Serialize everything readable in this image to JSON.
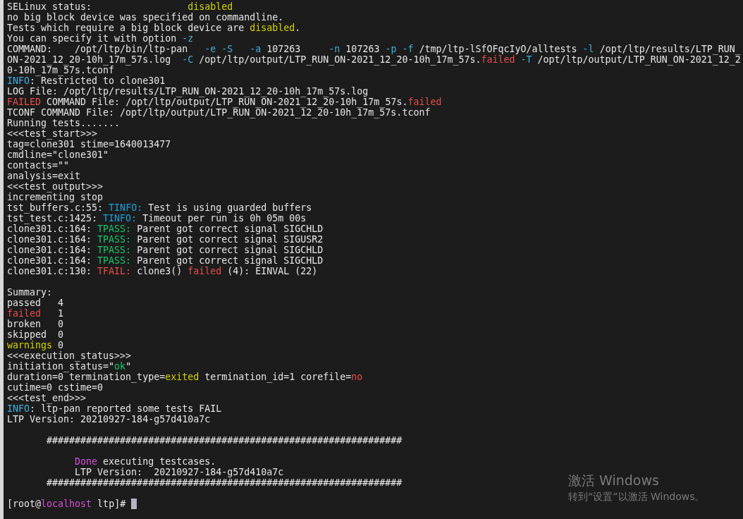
{
  "lines": [
    {
      "kind": "text",
      "segments": [
        {
          "text": "SELinux status:                 "
        },
        {
          "text": "disabled",
          "color": "#d4d400"
        }
      ]
    },
    {
      "kind": "text",
      "segments": [
        {
          "text": "no big block device was specified on commandline."
        }
      ]
    },
    {
      "kind": "text",
      "segments": [
        {
          "text": "Tests which require a big block device are "
        },
        {
          "text": "disabled",
          "color": "#d4d400"
        },
        {
          "text": "."
        }
      ]
    },
    {
      "kind": "text",
      "segments": [
        {
          "text": "You can specify it with option "
        },
        {
          "text": "-z",
          "color": "#3fb0dc"
        }
      ]
    },
    {
      "kind": "text",
      "segments": [
        {
          "text": "COMMAND:    /opt/ltp/bin/ltp-pan   "
        },
        {
          "text": "-e -S   -a",
          "color": "#3fb0dc"
        },
        {
          "text": " 107263     "
        },
        {
          "text": "-n",
          "color": "#3fb0dc"
        },
        {
          "text": " 107263 "
        },
        {
          "text": "-p -f",
          "color": "#3fb0dc"
        },
        {
          "text": " /tmp/ltp-lSfOFqcIyO/alltests "
        },
        {
          "text": "-l",
          "color": "#3fb0dc"
        },
        {
          "text": " /opt/ltp/results/LTP_RUN_"
        }
      ]
    },
    {
      "kind": "text",
      "segments": [
        {
          "text": "ON-2021_12_20-10h_17m_57s.log  "
        },
        {
          "text": "-C",
          "color": "#3fb0dc"
        },
        {
          "text": " /opt/ltp/output/LTP_RUN_ON-2021_12_20-10h_17m_57s."
        },
        {
          "text": "failed",
          "color": "#e84c4c"
        },
        {
          "text": " -T",
          "color": "#3fb0dc"
        },
        {
          "text": " /opt/ltp/output/LTP_RUN_ON-2021_12_2"
        }
      ]
    },
    {
      "kind": "text",
      "segments": [
        {
          "text": "0-10h_17m_57s.tconf"
        }
      ]
    },
    {
      "kind": "text",
      "segments": [
        {
          "text": "INFO",
          "color": "#3fb0dc"
        },
        {
          "text": ": Restricted to clone301"
        }
      ]
    },
    {
      "kind": "text",
      "segments": [
        {
          "text": "LOG File: /opt/ltp/results/LTP_RUN_ON-2021_12_20-10h_17m_57s.log"
        }
      ]
    },
    {
      "kind": "text",
      "segments": [
        {
          "text": "FAILED",
          "color": "#e84c4c"
        },
        {
          "text": " COMMAND File: /opt/ltp/output/LTP_RUN_ON-2021_12_20-10h_17m_57s."
        },
        {
          "text": "failed",
          "color": "#e84c4c"
        }
      ]
    },
    {
      "kind": "text",
      "segments": [
        {
          "text": "TCONF COMMAND File: /opt/ltp/output/LTP_RUN_ON-2021_12_20-10h_17m_57s.tconf"
        }
      ]
    },
    {
      "kind": "text",
      "segments": [
        {
          "text": "Running tests......."
        }
      ]
    },
    {
      "kind": "text",
      "segments": [
        {
          "text": "<<<test_start>>>"
        }
      ]
    },
    {
      "kind": "text",
      "segments": [
        {
          "text": "tag=clone301 stime=1640013477"
        }
      ]
    },
    {
      "kind": "text",
      "segments": [
        {
          "text": "cmdline=\"clone301\""
        }
      ]
    },
    {
      "kind": "text",
      "segments": [
        {
          "text": "contacts=\"\""
        }
      ]
    },
    {
      "kind": "text",
      "segments": [
        {
          "text": "analysis=exit"
        }
      ]
    },
    {
      "kind": "text",
      "segments": [
        {
          "text": "<<<test_output>>>"
        }
      ]
    },
    {
      "kind": "text",
      "segments": [
        {
          "text": "incrementing stop"
        }
      ]
    },
    {
      "kind": "text",
      "segments": [
        {
          "text": "tst_buffers.c:55: "
        },
        {
          "text": "TINFO:",
          "color": "#1e9fd6"
        },
        {
          "text": " Test is using guarded buffers"
        }
      ]
    },
    {
      "kind": "text",
      "segments": [
        {
          "text": "tst_test.c:1425: "
        },
        {
          "text": "TINFO:",
          "color": "#1e9fd6"
        },
        {
          "text": " Timeout per run is 0h 05m 00s"
        }
      ]
    },
    {
      "kind": "text",
      "segments": [
        {
          "text": "clone301.c:164: "
        },
        {
          "text": "TPASS:",
          "color": "#17c56a"
        },
        {
          "text": " Parent got correct signal SIGCHLD"
        }
      ]
    },
    {
      "kind": "text",
      "segments": [
        {
          "text": "clone301.c:164: "
        },
        {
          "text": "TPASS:",
          "color": "#17c56a"
        },
        {
          "text": " Parent got correct signal SIGUSR2"
        }
      ]
    },
    {
      "kind": "text",
      "segments": [
        {
          "text": "clone301.c:164: "
        },
        {
          "text": "TPASS:",
          "color": "#17c56a"
        },
        {
          "text": " Parent got correct signal SIGCHLD"
        }
      ]
    },
    {
      "kind": "text",
      "segments": [
        {
          "text": "clone301.c:164: "
        },
        {
          "text": "TPASS:",
          "color": "#17c56a"
        },
        {
          "text": " Parent got correct signal SIGCHLD"
        }
      ]
    },
    {
      "kind": "text",
      "segments": [
        {
          "text": "clone301.c:130: "
        },
        {
          "text": "TFAIL:",
          "color": "#e84c4c"
        },
        {
          "text": " clone3() "
        },
        {
          "text": "failed",
          "color": "#e84c4c"
        },
        {
          "text": " (4): EINVAL (22)"
        }
      ]
    },
    {
      "kind": "blank"
    },
    {
      "kind": "text",
      "segments": [
        {
          "text": "Summary:"
        }
      ]
    },
    {
      "kind": "text",
      "segments": [
        {
          "text": "passed   4"
        }
      ]
    },
    {
      "kind": "text",
      "segments": [
        {
          "text": "failed",
          "color": "#e84c4c"
        },
        {
          "text": "   1"
        }
      ]
    },
    {
      "kind": "text",
      "segments": [
        {
          "text": "broken   0"
        }
      ]
    },
    {
      "kind": "text",
      "segments": [
        {
          "text": "skipped  0"
        }
      ]
    },
    {
      "kind": "text",
      "segments": [
        {
          "text": "warnings",
          "color": "#d4d400"
        },
        {
          "text": " 0"
        }
      ]
    },
    {
      "kind": "text",
      "segments": [
        {
          "text": "<<<execution_status>>>"
        }
      ]
    },
    {
      "kind": "text",
      "segments": [
        {
          "text": "initiation_status=\""
        },
        {
          "text": "ok",
          "color": "#17c56a"
        },
        {
          "text": "\""
        }
      ]
    },
    {
      "kind": "text",
      "segments": [
        {
          "text": "duration=0 termination_type="
        },
        {
          "text": "exited",
          "color": "#d4d400"
        },
        {
          "text": " termination_id=1 corefile="
        },
        {
          "text": "no",
          "color": "#e84c4c"
        }
      ]
    },
    {
      "kind": "text",
      "segments": [
        {
          "text": "cutime=0 cstime=0"
        }
      ]
    },
    {
      "kind": "text",
      "segments": [
        {
          "text": "<<<test_end>>>"
        }
      ]
    },
    {
      "kind": "text",
      "segments": [
        {
          "text": "INFO",
          "color": "#3fb0dc"
        },
        {
          "text": ": ltp-pan reported some tests FAIL"
        }
      ]
    },
    {
      "kind": "text",
      "segments": [
        {
          "text": "LTP Version: 20210927-184-g57d410a7c"
        }
      ]
    },
    {
      "kind": "blank"
    },
    {
      "kind": "text",
      "segments": [
        {
          "text": "       ###############################################################"
        }
      ]
    },
    {
      "kind": "blank"
    },
    {
      "kind": "text",
      "segments": [
        {
          "text": "            Done",
          "color": "#d94fd9"
        },
        {
          "text": " executing testcases."
        }
      ]
    },
    {
      "kind": "text",
      "segments": [
        {
          "text": "            LTP Version:  20210927-184-g57d410a7c"
        }
      ]
    },
    {
      "kind": "text",
      "segments": [
        {
          "text": "       ###############################################################"
        }
      ]
    },
    {
      "kind": "blank"
    },
    {
      "kind": "prompt",
      "segments": [
        {
          "text": "[root@"
        },
        {
          "text": "localhost",
          "color": "#d94fd9"
        },
        {
          "text": " ltp]# "
        }
      ]
    }
  ],
  "activation": {
    "title": "激活 Windows",
    "subtitle": "转到“设置”以激活 Windows。"
  }
}
